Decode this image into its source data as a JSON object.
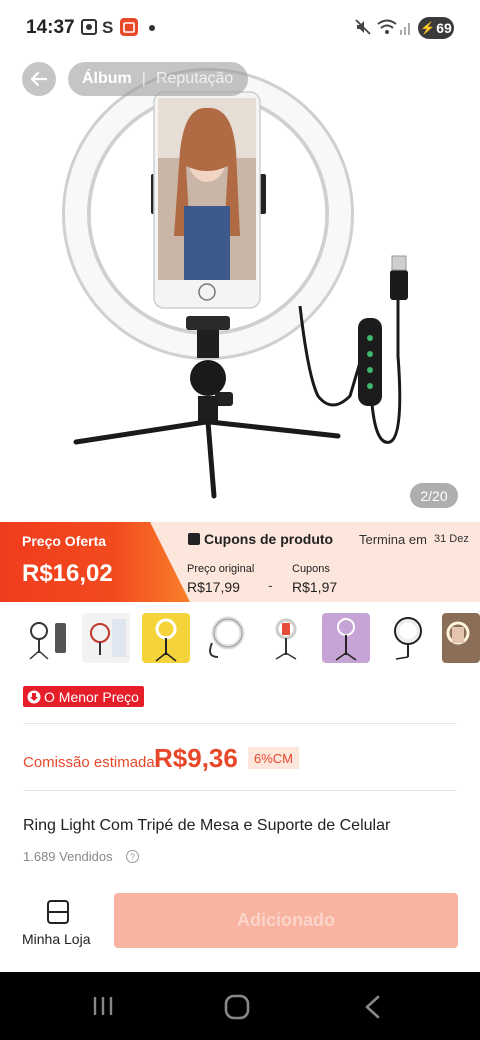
{
  "status_bar": {
    "time": "14:37",
    "battery": "69"
  },
  "gallery": {
    "tabs": [
      "Álbum",
      "Reputação"
    ],
    "page_counter": "2/20"
  },
  "price_banner": {
    "offer_label": "Preço Oferta",
    "offer_price": "R$16,02",
    "coupon_title": "Cupons de produto",
    "ends_label": "Termina em",
    "ends_date": "31 Dez",
    "original_label": "Preço original",
    "original_value": "R$17,99",
    "minus": "-",
    "coupon_label": "Cupons",
    "coupon_value": "R$1,97"
  },
  "badges": {
    "lowest_price": "O Menor Preço"
  },
  "commission": {
    "label": "Comissão estimada",
    "value": "R$9,36",
    "tag": "6%CM"
  },
  "product": {
    "title": "Ring Light Com Tripé de Mesa e Suporte de Celular",
    "sold": "1.689 Vendidos",
    "help": "?"
  },
  "actions": {
    "store_label": "Minha Loja",
    "added_label": "Adicionado"
  },
  "colors": {
    "accent": "#e8482a",
    "badge_red": "#e61e2a",
    "button_disabled": "#f8b3a1"
  }
}
